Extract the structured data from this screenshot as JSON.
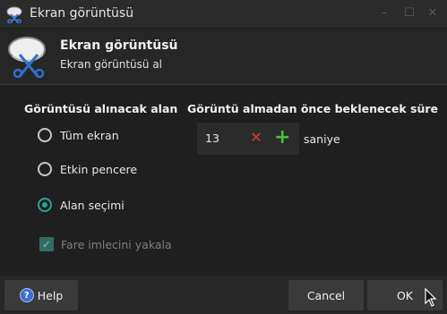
{
  "window": {
    "title": "Ekran görüntüsü",
    "icon": "screenshot-scissors-icon"
  },
  "header": {
    "title": "Ekran görüntüsü",
    "subtitle": "Ekran görüntüsü al"
  },
  "area_group": {
    "title": "Görüntüsü alınacak alan",
    "options": [
      {
        "label": "Tüm ekran",
        "checked": false
      },
      {
        "label": "Etkin pencere",
        "checked": false
      },
      {
        "label": "Alan seçimi",
        "checked": true
      }
    ],
    "cursor_checkbox": {
      "label": "Fare imlecini yakala",
      "checked": true,
      "enabled": false
    }
  },
  "delay_group": {
    "title": "Görüntü almadan önce beklenecek süre",
    "value": "13",
    "unit": "saniye"
  },
  "buttons": {
    "help": "Help",
    "cancel": "Cancel",
    "ok": "OK"
  },
  "colors": {
    "accent": "#2aa596",
    "clear": "#d23c3c",
    "add": "#3ec43e"
  }
}
